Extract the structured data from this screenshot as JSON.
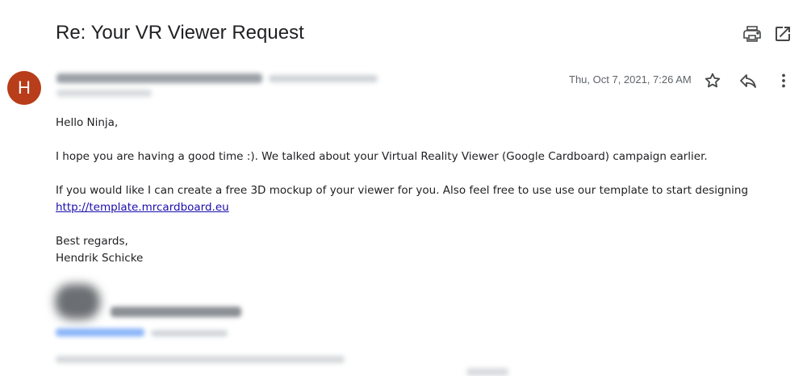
{
  "email": {
    "subject": "Re: Your VR Viewer Request",
    "sender_initial": "H",
    "date": "Thu, Oct 7, 2021, 7:26 AM"
  },
  "icons": {
    "print": "print-icon",
    "open_new_window": "open-in-new-window-icon",
    "star": "star-icon",
    "reply": "reply-icon",
    "more": "more-vertical-icon"
  },
  "body": {
    "greeting": "Hello Ninja,",
    "paragraph1": "I hope you are having a good time :). We talked about your Virtual Reality Viewer (Google Cardboard) campaign earlier.",
    "paragraph2": "If you would like I can create a free 3D mockup of your viewer for you. Also feel free to use use our template to start designing",
    "link": "http://template.mrcardboard.eu",
    "closing": "Best regards,",
    "signature_name": "Hendrik Schicke"
  },
  "colors": {
    "avatar": "#b83d1a",
    "link": "#1a0dab",
    "secondary_text": "#5f6368"
  }
}
